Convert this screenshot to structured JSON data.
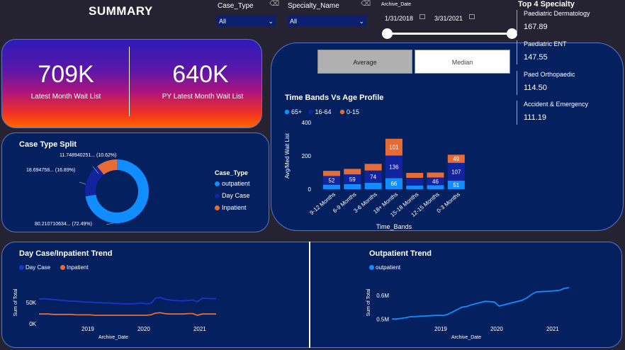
{
  "header": {
    "title": "SUMMARY"
  },
  "filters": {
    "case_type": {
      "label": "Case_Type",
      "value": "All"
    },
    "specialty_name": {
      "label": "Specialty_Name",
      "value": "All"
    },
    "archive_date": {
      "label": "Archive_Date",
      "start": "1/31/2018",
      "end": "3/31/2021"
    }
  },
  "kpis": {
    "latest": {
      "value": "709K",
      "label": "Latest Month Wait List"
    },
    "py_latest": {
      "value": "640K",
      "label": "PY Latest Month Wait List"
    }
  },
  "toggle": {
    "average": "Average",
    "median": "Median",
    "selected": "average"
  },
  "top4": {
    "title": "Top 4 Specialty",
    "items": [
      {
        "name": "Paediatric Dermatology",
        "value": "167.89"
      },
      {
        "name": "Paediatric ENT",
        "value": "147.55"
      },
      {
        "name": "Paed Orthopaedic",
        "value": "114.50"
      },
      {
        "name": "Accident & Emergency",
        "value": "111.19"
      }
    ]
  },
  "case_type_split": {
    "title": "Case Type Split",
    "legend_title": "Case_Type",
    "labels": {
      "inpatient": "11.748940251... (10.62%)",
      "daycase": "18.694758... (16.89%)",
      "outpatient": "80.210710634... (72.49%)"
    }
  },
  "time_bands": {
    "title": "Time Bands Vs Age Profile"
  },
  "day_case_trend": {
    "title": "Day Case/Inpatient Trend"
  },
  "outpatient_trend": {
    "title": "Outpatient Trend"
  },
  "colors": {
    "outpatient": "#118dff",
    "daycase": "#12239e",
    "inpatient": "#e66c37",
    "age_65": "#118dff",
    "age_16_64": "#12239e",
    "age_0_15": "#e66c37"
  },
  "chart_data": [
    {
      "type": "pie",
      "title": "Case Type Split",
      "legend": [
        "outpatient",
        "Day Case",
        "Inpatient"
      ],
      "values": [
        80.210710634,
        18.694758,
        11.748940251
      ],
      "percent_labels": [
        "72.49%",
        "16.89%",
        "10.62%"
      ]
    },
    {
      "type": "bar",
      "stacked": true,
      "title": "Time Bands Vs Age Profile",
      "xlabel": "Time_Bands",
      "ylabel": "Avg/Med Wait List",
      "ylim": [
        0,
        400
      ],
      "yticks": [
        "0",
        "200",
        "400"
      ],
      "categories": [
        "9-12 Months",
        "6-9 Months",
        "3-6 Months",
        "18+ Months",
        "15-18 Months",
        "12-15 Months",
        "0-3 Months"
      ],
      "series": [
        {
          "name": "65+",
          "values": [
            27,
            30,
            38,
            66,
            22,
            24,
            51
          ],
          "labels": [
            "",
            "",
            "",
            "66",
            "",
            "",
            "51"
          ]
        },
        {
          "name": "16-64",
          "values": [
            52,
            59,
            74,
            136,
            46,
            46,
            107
          ],
          "labels": [
            "52",
            "59",
            "74",
            "136",
            "",
            "46",
            "107"
          ]
        },
        {
          "name": "0-15",
          "values": [
            31,
            33,
            40,
            101,
            30,
            30,
            49
          ],
          "labels": [
            "",
            "",
            "",
            "101",
            "",
            "",
            "49"
          ]
        }
      ]
    },
    {
      "type": "line",
      "title": "Day Case/Inpatient Trend",
      "xlabel": "Archive_Date",
      "ylabel": "Sum of Total",
      "ylim": [
        0,
        100000
      ],
      "yticks": [
        "0K",
        "50K"
      ],
      "xticks": [
        "2019",
        "2020",
        "2021"
      ],
      "x_range": [
        "2018-01",
        "2021-03"
      ],
      "series": [
        {
          "name": "Day Case",
          "values": [
            58000,
            59000,
            58000,
            57000,
            56000,
            55000,
            54000,
            53000,
            53000,
            52000,
            51000,
            51000,
            50000,
            50000,
            49000,
            49000,
            48000,
            48000,
            47000,
            47000,
            47000,
            48000,
            49000,
            47000,
            48000,
            60000,
            62000,
            58000,
            56000,
            55000,
            54000,
            54000,
            55000,
            56000,
            52000,
            60000,
            60000,
            59000,
            59000
          ]
        },
        {
          "name": "Inpatient",
          "values": [
            23000,
            23000,
            23000,
            22000,
            22000,
            22000,
            22000,
            22000,
            21000,
            21000,
            21000,
            21000,
            20000,
            20000,
            20000,
            20000,
            20000,
            20000,
            20000,
            20000,
            20000,
            20000,
            20000,
            20000,
            21000,
            25000,
            26000,
            24000,
            23000,
            23000,
            23000,
            23000,
            24000,
            24000,
            20000,
            23000,
            23000,
            23000,
            23000
          ]
        }
      ]
    },
    {
      "type": "line",
      "title": "Outpatient Trend",
      "xlabel": "Archive_Date",
      "ylabel": "Sum of Total",
      "ylim": [
        0.48,
        0.66
      ],
      "yticks": [
        "0.5M",
        "0.6M"
      ],
      "xticks": [
        "2019",
        "2020",
        "2021"
      ],
      "x_range": [
        "2018-01",
        "2021-03"
      ],
      "series": [
        {
          "name": "outpatient",
          "values": [
            0.5,
            0.5,
            0.503,
            0.506,
            0.51,
            0.51,
            0.512,
            0.513,
            0.514,
            0.515,
            0.516,
            0.515,
            0.52,
            0.53,
            0.54,
            0.55,
            0.553,
            0.56,
            0.565,
            0.57,
            0.575,
            0.574,
            0.572,
            0.555,
            0.56,
            0.565,
            0.57,
            0.575,
            0.58,
            0.59,
            0.605,
            0.615,
            0.616,
            0.617,
            0.618,
            0.62,
            0.622,
            0.63,
            0.633
          ]
        }
      ]
    }
  ]
}
